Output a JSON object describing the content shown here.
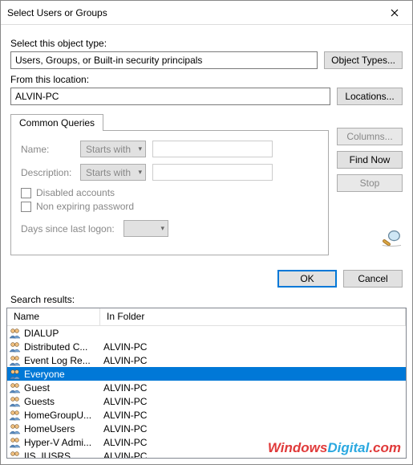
{
  "window": {
    "title": "Select Users or Groups"
  },
  "labels": {
    "object_type": "Select this object type:",
    "from_location": "From this location:",
    "tab": "Common Queries",
    "name": "Name:",
    "description": "Description:",
    "starts_with": "Starts with",
    "disabled_accounts": "Disabled accounts",
    "non_expiring": "Non expiring password",
    "days_logon": "Days since last logon:",
    "search_results": "Search results:",
    "col_name": "Name",
    "col_folder": "In Folder"
  },
  "fields": {
    "object_type_value": "Users, Groups, or Built-in security principals",
    "location_value": "ALVIN-PC"
  },
  "buttons": {
    "object_types": "Object Types...",
    "locations": "Locations...",
    "columns": "Columns...",
    "find_now": "Find Now",
    "stop": "Stop",
    "ok": "OK",
    "cancel": "Cancel"
  },
  "results": [
    {
      "name": "DIALUP",
      "folder": ""
    },
    {
      "name": "Distributed C...",
      "folder": "ALVIN-PC"
    },
    {
      "name": "Event Log Re...",
      "folder": "ALVIN-PC"
    },
    {
      "name": "Everyone",
      "folder": "",
      "selected": true
    },
    {
      "name": "Guest",
      "folder": "ALVIN-PC"
    },
    {
      "name": "Guests",
      "folder": "ALVIN-PC"
    },
    {
      "name": "HomeGroupU...",
      "folder": "ALVIN-PC"
    },
    {
      "name": "HomeUsers",
      "folder": "ALVIN-PC"
    },
    {
      "name": "Hyper-V Admi...",
      "folder": "ALVIN-PC"
    },
    {
      "name": "IIS_IUSRS",
      "folder": "ALVIN-PC"
    }
  ],
  "watermark": {
    "part1": "Windows",
    "part2": "Digital",
    "part3": ".com"
  }
}
